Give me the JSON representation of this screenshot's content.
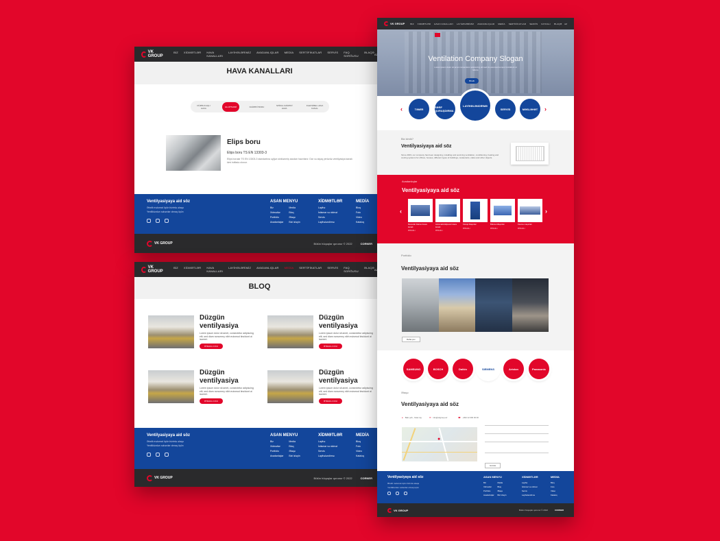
{
  "nav": {
    "logo_text": "VK GROUP",
    "links": [
      "BIZ",
      "XIDMƏTLƏR",
      "HAVA KANALLARI",
      "LAYİHƏLƏRİMİZ",
      "AVADANLIQLAR",
      "MEDİA",
      "SERTİFİKATLAR",
      "SERVİS",
      "FAYDALI",
      "ƏLAQƏ"
    ],
    "lang": "AZ",
    "hava_links": [
      "BİZ",
      "XİDMƏTLƏR",
      "HAVA KANALLARI",
      "LAYİHƏLƏRİMİZ",
      "AVADANLIQLAR",
      "MEDİA",
      "SERTİFİKATLAR",
      "SERVİS",
      "FAQ SORĞUSU",
      "ƏLAQƏ"
    ]
  },
  "hava": {
    "title": "HAVA KANALLARI",
    "tabs": [
      "DÜZBUCAQLI HAVA",
      "ELLİPSVARİ",
      "DAİRƏVİ BORU",
      "SPİRAL DAİRƏVİ HAVA",
      "FLEKSİBEL HAVA KANAL"
    ],
    "product_name": "Elips boru",
    "product_std": "Elips boru TS EN 13303-3",
    "product_desc": "Elips borular TS EN 13303-3 standartına uyğun sinklənmiş sacdan hazırlanır. Dar və alçaq yerlərdə ventilyasiya kanalı kimi istifadə olunur."
  },
  "footer": {
    "heading": "Ventilyasiyaya aid söz",
    "sub1": "Ətraflı məlumat üçün bizimlə əlaqə",
    "sub2": "Yeniliklərdən xəbərdar olmaq üçün",
    "menu_title": "ASAN MENYU",
    "menu_col1": [
      "Biz",
      "Xidmətlər",
      "Portfolio",
      "Avadanlıqlar"
    ],
    "menu_col2": [
      "Media",
      "Bloq",
      "Əlaqə",
      "Bizi izləyin"
    ],
    "services_title": "XİDMƏTLƏR",
    "services": [
      "Layihə",
      "İstismar və xidmət",
      "Servis",
      "Layihələndirmə"
    ],
    "media_title": "MEDİA",
    "media": [
      "Bloq",
      "Foto",
      "Video",
      "Kataloq"
    ],
    "copyright": "Bütün hüquqlar qorunur © 2022",
    "brand": "CORNER"
  },
  "bloq": {
    "title": "BLOQ",
    "post_title": "Düzgün ventilyasiya",
    "post_text": "Lorem ipsum dolor sit amet, consectetur adipiscing elit, sed diam nonummy nibh euismod tincidunt ut laoreet.",
    "btn": "ƏTRAFLI OXU"
  },
  "home": {
    "slogan": "Ventilation Company Slogan",
    "hero_text": "Lorem ipsum dolor sit amet consectetur adipiscing elit sed do eiusmod tempor incididunt ut labore",
    "hero_btn": "Ətraflı",
    "circles": [
      "TƏMİR",
      "SƏRF QURAŞDIRMA",
      "LAYİHƏLƏNDİRMƏ",
      "SERVİS",
      "MƏSLƏHƏT"
    ],
    "about_label": "Biz kimik?",
    "section_title": "Ventilyasiyaya aid söz",
    "about_text": "Since 2003, our company has been designing, installing and servicing ventilation, conditioning, heating and cooling systems for offices, houses, different types of buildings, restaurants, cafes and other objects.",
    "equip_label": "Avadanlıqlar",
    "products": [
      "Mexaniki Dairəvi Hava kanalı",
      "Avtomatik Elipsvari Hava kanalı",
      "Flanşlı Maşınlar",
      "Bükmə Maşınları",
      "Kəsmə maşınları"
    ],
    "product_btn": "ƏTRAFLI",
    "portfolio_label": "Portfolio",
    "portfolio_btn": "Daha çox",
    "brands": [
      "SAMSUNG",
      "BOSCH",
      "Daikin",
      "SIEMENS",
      "Ariston",
      "Panasonic"
    ],
    "contact_label": "Əlaqə",
    "contact": [
      "Bakı şəh., Xətai ray.",
      "info@vkgroup.az",
      "+994 12 000 00 00"
    ],
    "send_btn": "Göndər"
  }
}
